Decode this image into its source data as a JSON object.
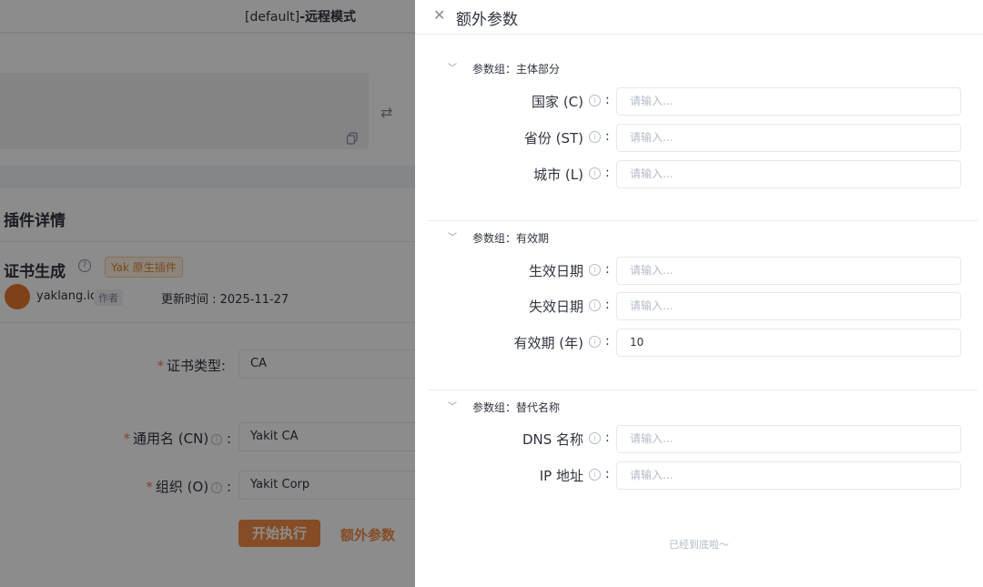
{
  "window": {
    "title_prefix": "[default]",
    "title_suffix": "-远程模式"
  },
  "plugin": {
    "section_title": "插件详情",
    "name": "证书生成",
    "tag": "Yak 原生插件",
    "author": "yaklang.io",
    "author_tag": "作者",
    "update_time": "更新时间 : 2025-11-27"
  },
  "form": {
    "fields": [
      {
        "label": "证书类型:",
        "value": "CA",
        "required": true
      },
      {
        "label": "通用名 (CN)",
        "value": "Yakit CA",
        "required": true
      },
      {
        "label": "组织 (O)",
        "value": "Yakit Corp",
        "required": true
      }
    ],
    "start_button": "开始执行",
    "extra_button": "额外参数"
  },
  "drawer": {
    "title": "额外参数",
    "close_glyph": "✕",
    "groups": [
      {
        "label": "参数组：主体部分",
        "fields": [
          {
            "label": "国家 (C)",
            "value": "",
            "placeholder": "请输入..."
          },
          {
            "label": "省份 (ST)",
            "value": "",
            "placeholder": "请输入..."
          },
          {
            "label": "城市 (L)",
            "value": "",
            "placeholder": "请输入..."
          }
        ]
      },
      {
        "label": "参数组：有效期",
        "fields": [
          {
            "label": "生效日期",
            "value": "",
            "placeholder": "请输入..."
          },
          {
            "label": "失效日期",
            "value": "",
            "placeholder": "请输入..."
          },
          {
            "label": "有效期 (年)",
            "value": "10",
            "placeholder": "请输入..."
          }
        ]
      },
      {
        "label": "参数组：替代名称",
        "fields": [
          {
            "label": "DNS 名称",
            "value": "",
            "placeholder": "请输入..."
          },
          {
            "label": "IP 地址",
            "value": "",
            "placeholder": "请输入..."
          }
        ]
      }
    ],
    "bottom_note": "已经到底啦～"
  },
  "colors": {
    "accent": "#f28b44",
    "required": "#f4736b",
    "mask": "rgba(0,0,0,0.45)"
  }
}
